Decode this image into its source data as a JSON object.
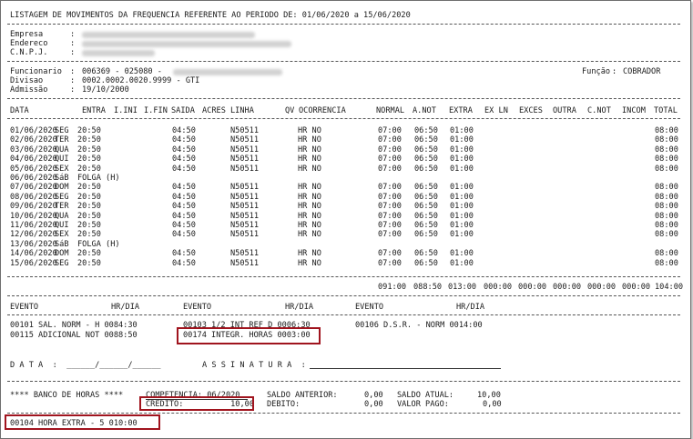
{
  "title": "LISTAGEM DE MOVIMENTOS DA FREQUENCIA REFERENTE AO PERIODO DE: 01/06/2020 a 15/06/2020",
  "company": {
    "empresa_label": "Empresa",
    "endereco_label": "Endereco",
    "cnpj_label": "C.N.P.J."
  },
  "employee": {
    "funcionario_label": "Funcionario",
    "funcionario_value": "006369 - 025080 -",
    "divisao_label": "Divisao",
    "divisao_value": "0002.0002.0020.9999 - GTI",
    "admissao_label": "Admissão",
    "admissao_value": "19/10/2000",
    "funcao_label": "Função",
    "funcao_value": "COBRADOR"
  },
  "columns": [
    "DATA",
    "ENTRA",
    "I.INI",
    "I.FIN",
    "SAIDA",
    "ACRES",
    "LINHA",
    "QV",
    "OCORRENCIA",
    "NORMAL",
    "A.NOT",
    "EXTRA",
    "EX LN",
    "EXCES",
    "OUTRA",
    "C.NOT",
    "INCOM",
    "TOTAL"
  ],
  "rows": [
    {
      "date": "01/06/2020",
      "day": "SEG",
      "entra": "20:50",
      "saida": "04:50",
      "linha": "N50511",
      "ocorr": "HR NO",
      "normal": "07:00",
      "anot": "06:50",
      "extra": "01:00",
      "total": "08:00"
    },
    {
      "date": "02/06/2020",
      "day": "TER",
      "entra": "20:50",
      "saida": "04:50",
      "linha": "N50511",
      "ocorr": "HR NO",
      "normal": "07:00",
      "anot": "06:50",
      "extra": "01:00",
      "total": "08:00"
    },
    {
      "date": "03/06/2020",
      "day": "QUA",
      "entra": "20:50",
      "saida": "04:50",
      "linha": "N50511",
      "ocorr": "HR NO",
      "normal": "07:00",
      "anot": "06:50",
      "extra": "01:00",
      "total": "08:00"
    },
    {
      "date": "04/06/2020",
      "day": "QUI",
      "entra": "20:50",
      "saida": "04:50",
      "linha": "N50511",
      "ocorr": "HR NO",
      "normal": "07:00",
      "anot": "06:50",
      "extra": "01:00",
      "total": "08:00"
    },
    {
      "date": "05/06/2020",
      "day": "SEX",
      "entra": "20:50",
      "saida": "04:50",
      "linha": "N50511",
      "ocorr": "HR NO",
      "normal": "07:00",
      "anot": "06:50",
      "extra": "01:00",
      "total": "08:00"
    },
    {
      "date": "06/06/2020",
      "day": "SáB",
      "folga": "FOLGA (H)"
    },
    {
      "date": "07/06/2020",
      "day": "DOM",
      "entra": "20:50",
      "saida": "04:50",
      "linha": "N50511",
      "ocorr": "HR NO",
      "normal": "07:00",
      "anot": "06:50",
      "extra": "01:00",
      "total": "08:00"
    },
    {
      "date": "08/06/2020",
      "day": "SEG",
      "entra": "20:50",
      "saida": "04:50",
      "linha": "N50511",
      "ocorr": "HR NO",
      "normal": "07:00",
      "anot": "06:50",
      "extra": "01:00",
      "total": "08:00"
    },
    {
      "date": "09/06/2020",
      "day": "TER",
      "entra": "20:50",
      "saida": "04:50",
      "linha": "N50511",
      "ocorr": "HR NO",
      "normal": "07:00",
      "anot": "06:50",
      "extra": "01:00",
      "total": "08:00"
    },
    {
      "date": "10/06/2020",
      "day": "QUA",
      "entra": "20:50",
      "saida": "04:50",
      "linha": "N50511",
      "ocorr": "HR NO",
      "normal": "07:00",
      "anot": "06:50",
      "extra": "01:00",
      "total": "08:00"
    },
    {
      "date": "11/06/2020",
      "day": "QUI",
      "entra": "20:50",
      "saida": "04:50",
      "linha": "N50511",
      "ocorr": "HR NO",
      "normal": "07:00",
      "anot": "06:50",
      "extra": "01:00",
      "total": "08:00"
    },
    {
      "date": "12/06/2020",
      "day": "SEX",
      "entra": "20:50",
      "saida": "04:50",
      "linha": "N50511",
      "ocorr": "HR NO",
      "normal": "07:00",
      "anot": "06:50",
      "extra": "01:00",
      "total": "08:00"
    },
    {
      "date": "13/06/2020",
      "day": "SáB",
      "folga": "FOLGA (H)"
    },
    {
      "date": "14/06/2020",
      "day": "DOM",
      "entra": "20:50",
      "saida": "04:50",
      "linha": "N50511",
      "ocorr": "HR NO",
      "normal": "07:00",
      "anot": "06:50",
      "extra": "01:00",
      "total": "08:00"
    },
    {
      "date": "15/06/2020",
      "day": "SEG",
      "entra": "20:50",
      "saida": "04:50",
      "linha": "N50511",
      "ocorr": "HR NO",
      "normal": "07:00",
      "anot": "06:50",
      "extra": "01:00",
      "total": "08:00"
    }
  ],
  "totals": [
    "091:00",
    "088:50",
    "013:00",
    "000:00",
    "000:00",
    "000:00",
    "000:00",
    "000:00",
    "104:00"
  ],
  "events": {
    "headers": [
      "EVENTO",
      "HR/DIA",
      "EVENTO",
      "HR/DIA",
      "EVENTO",
      "HR/DIA"
    ],
    "items": [
      "00101 SAL. NORM - H 0084:30",
      "00103 1/2 INT REF D 0006:30",
      "00106 D.S.R. - NORM 0014:00",
      "00115 ADICIONAL NOT 0088:50",
      "00174 INTEGR. HORAS 0003:00"
    ]
  },
  "signature": {
    "data_label": "D A T A  :  ______/______/______",
    "assinatura_label": "A S S I N A T U R A  :"
  },
  "bank": {
    "title": "**** BANCO DE HORAS ****",
    "competencia": "COMPETENCIA: 06/2020",
    "credito": "CREDITO:          10,00",
    "saldo_anterior_label": "SALDO ANTERIOR:",
    "saldo_anterior_value": "0,00",
    "debito_label": "DEBITO:",
    "debito_value": "0,00",
    "saldo_atual_label": "SALDO ATUAL:",
    "saldo_atual_value": "10,00",
    "valor_pago_label": "VALOR PAGO:",
    "valor_pago_value": "0,00"
  },
  "footer_event": "00104 HORA EXTRA - 5 010:00",
  "colors": {
    "highlight_border": "#a0141e",
    "text": "#1b1b1b"
  }
}
